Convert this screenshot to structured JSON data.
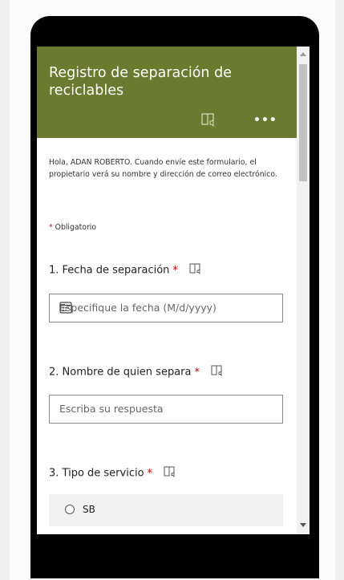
{
  "form": {
    "title": "Registro de separación de reciclables",
    "intro": "Hola, ADAN ROBERTO. Cuando envíe este formulario, el propietario verá su nombre y dirección de correo electrónico.",
    "required_star": "*",
    "required_text": "Obligatorio",
    "more_label": "•••",
    "header_color": "#6b7a2e"
  },
  "questions": [
    {
      "label": "1. Fecha de separación",
      "star": "*",
      "placeholder": "Especifique la fecha (M/d/yyyy)"
    },
    {
      "label": "2. Nombre de quien separa",
      "star": "*",
      "placeholder": "Escriba su respuesta"
    },
    {
      "label": "3. Tipo de servicio",
      "star": "*",
      "options": [
        "SB"
      ]
    }
  ]
}
